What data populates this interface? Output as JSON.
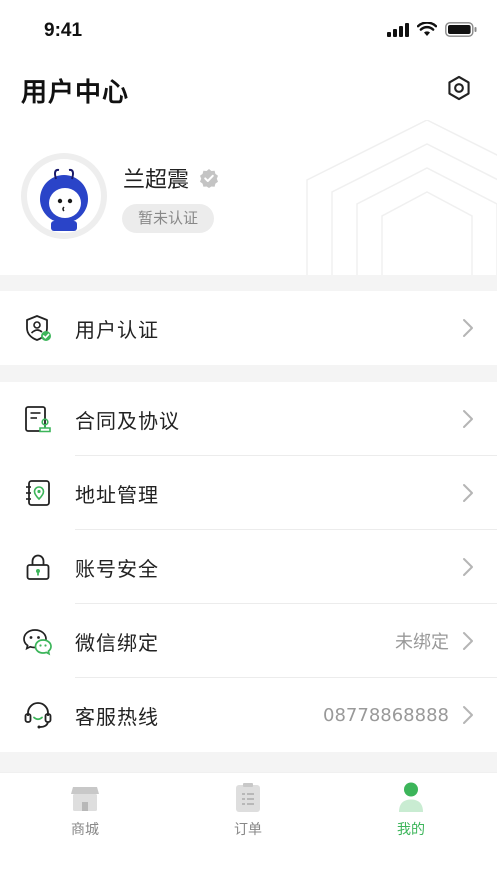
{
  "status_bar": {
    "time": "9:41"
  },
  "header": {
    "title": "用户中心"
  },
  "profile": {
    "name": "兰超震",
    "auth_status": "暂未认证"
  },
  "menu_group_1": [
    {
      "label": "用户认证",
      "icon": "shield-user-icon"
    }
  ],
  "menu_group_2": [
    {
      "label": "合同及协议",
      "icon": "contract-icon",
      "value": ""
    },
    {
      "label": "地址管理",
      "icon": "address-book-icon",
      "value": ""
    },
    {
      "label": "账号安全",
      "icon": "lock-icon",
      "value": ""
    },
    {
      "label": "微信绑定",
      "icon": "wechat-icon",
      "value": "未绑定"
    },
    {
      "label": "客服热线",
      "icon": "headset-icon",
      "value": "08778868888"
    }
  ],
  "tabbar": [
    {
      "label": "商城",
      "icon": "store-icon",
      "active": false
    },
    {
      "label": "订单",
      "icon": "order-icon",
      "active": false
    },
    {
      "label": "我的",
      "icon": "user-icon",
      "active": true
    }
  ],
  "colors": {
    "accent": "#3cb55a",
    "chevron": "#b5b5b5",
    "section_gap": "#f4f4f4"
  }
}
